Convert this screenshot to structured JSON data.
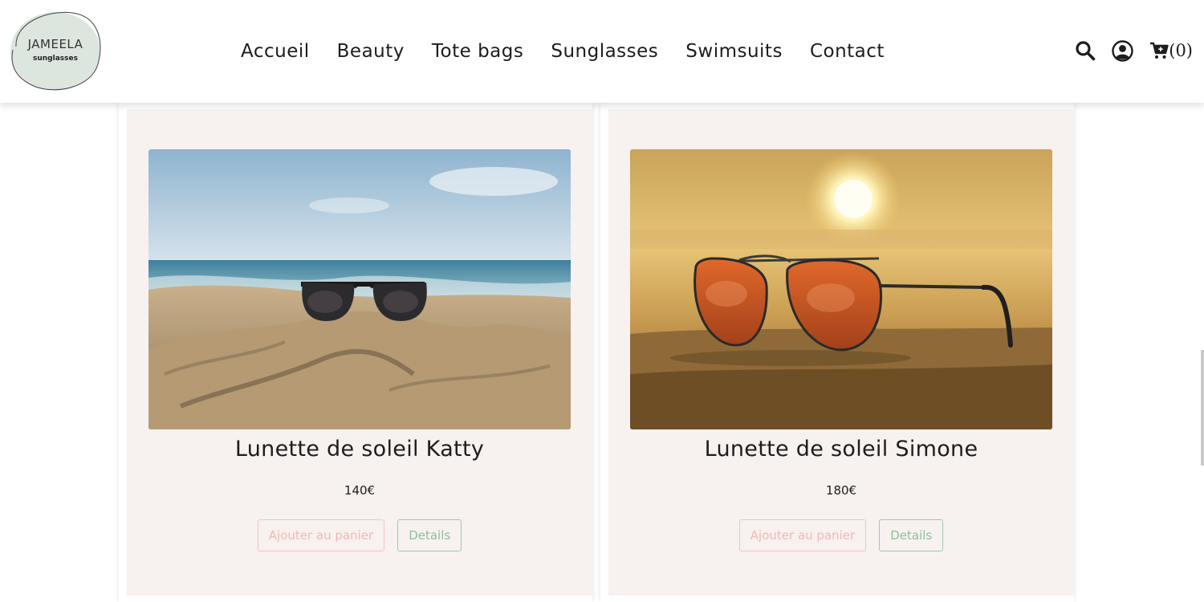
{
  "brand": {
    "name": "JAMEELA",
    "tagline": "sunglasses"
  },
  "nav": {
    "items": [
      {
        "label": "Accueil"
      },
      {
        "label": "Beauty"
      },
      {
        "label": "Tote bags"
      },
      {
        "label": "Sunglasses"
      },
      {
        "label": "Swimsuits"
      },
      {
        "label": "Contact"
      }
    ]
  },
  "header_icons": {
    "search": "search-icon",
    "account": "user-circle-icon",
    "cart": "cart-icon",
    "cart_count": "(0)"
  },
  "products": [
    {
      "name": "Lunette de soleil Katty",
      "price": "140€",
      "add_to_cart_label": "Ajouter au panier",
      "details_label": "Details"
    },
    {
      "name": "Lunette de soleil Simone",
      "price": "180€",
      "add_to_cart_label": "Ajouter au panier",
      "details_label": "Details"
    }
  ],
  "colors": {
    "card_background": "#f7f1ef",
    "cart_button": "#f0b8b2",
    "details_button": "#8fbf9c",
    "logo_circle": "#dde5df"
  }
}
